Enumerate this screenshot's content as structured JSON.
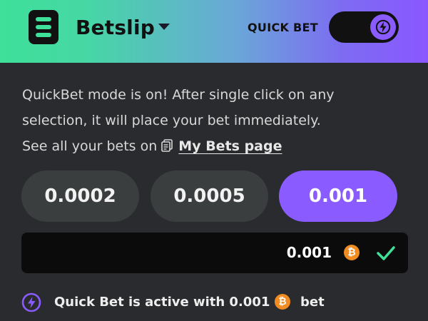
{
  "header": {
    "title": "Betslip",
    "quick_bet_label": "QUICK BET",
    "quick_bet_on": true
  },
  "info": {
    "line1": "QuickBet mode is on! After single click on any",
    "line2": "selection, it will place your bet immediately.",
    "line3_prefix": "See all your bets on",
    "link_label": "My Bets page"
  },
  "chips": [
    {
      "label": "0.0002",
      "selected": false
    },
    {
      "label": "0.0005",
      "selected": false
    },
    {
      "label": "0.001",
      "selected": true
    }
  ],
  "amount": {
    "value": "0.001",
    "currency_icon": "bitcoin-icon",
    "currency_symbol": "₿"
  },
  "status": {
    "text": "Quick Bet is active with 0.001",
    "suffix": "bet"
  },
  "colors": {
    "accent": "#8a5cff",
    "green": "#3ee09a",
    "bitcoin": "#f08c21"
  }
}
